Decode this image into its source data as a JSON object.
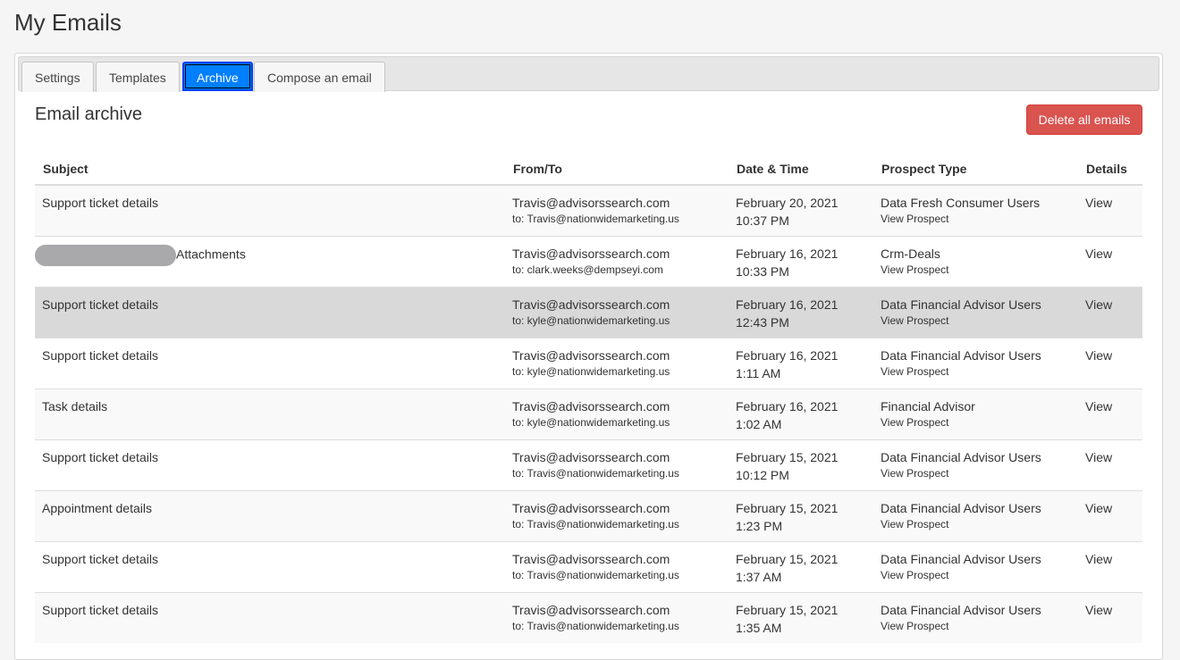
{
  "page_title": "My Emails",
  "tabs": [
    {
      "label": "Settings",
      "active": false
    },
    {
      "label": "Templates",
      "active": false
    },
    {
      "label": "Archive",
      "active": true
    },
    {
      "label": "Compose an email",
      "active": false
    }
  ],
  "section_title": "Email archive",
  "delete_all_label": "Delete all emails",
  "columns": [
    "Subject",
    "From/To",
    "Date & Time",
    "Prospect Type",
    "Details"
  ],
  "rows": [
    {
      "subject": "Support ticket details",
      "from": "Travis@advisorssearch.com",
      "to": "to: Travis@nationwidemarketing.us",
      "date": "February 20, 2021",
      "time": "10:37 PM",
      "type": "Data Fresh Consumer Users",
      "type_link": "View Prospect",
      "details": "View"
    },
    {
      "subject": "Attachments",
      "subject_redacted": true,
      "from": "Travis@advisorssearch.com",
      "to": "to: clark.weeks@dempseyi.com",
      "date": "February 16, 2021",
      "time": "10:33 PM",
      "type": "Crm-Deals",
      "type_link": "View Prospect",
      "details": "View"
    },
    {
      "subject": "Support ticket details",
      "from": "Travis@advisorssearch.com",
      "to": "to: kyle@nationwidemarketing.us",
      "date": "February 16, 2021",
      "time": "12:43 PM",
      "type": "Data Financial Advisor Users",
      "type_link": "View Prospect",
      "details": "View",
      "hover": true
    },
    {
      "subject": "Support ticket details",
      "from": "Travis@advisorssearch.com",
      "to": "to: kyle@nationwidemarketing.us",
      "date": "February 16, 2021",
      "time": "1:11 AM",
      "type": "Data Financial Advisor Users",
      "type_link": "View Prospect",
      "details": "View"
    },
    {
      "subject": "Task details",
      "from": "Travis@advisorssearch.com",
      "to": "to: kyle@nationwidemarketing.us",
      "date": "February 16, 2021",
      "time": "1:02 AM",
      "type": "Financial Advisor",
      "type_link": "View Prospect",
      "details": "View"
    },
    {
      "subject": "Support ticket details",
      "from": "Travis@advisorssearch.com",
      "to": "to: Travis@nationwidemarketing.us",
      "date": "February 15, 2021",
      "time": "10:12 PM",
      "type": "Data Financial Advisor Users",
      "type_link": "View Prospect",
      "details": "View"
    },
    {
      "subject": "Appointment details",
      "from": "Travis@advisorssearch.com",
      "to": "to: Travis@nationwidemarketing.us",
      "date": "February 15, 2021",
      "time": "1:23 PM",
      "type": "Data Financial Advisor Users",
      "type_link": "View Prospect",
      "details": "View"
    },
    {
      "subject": "Support ticket details",
      "from": "Travis@advisorssearch.com",
      "to": "to: Travis@nationwidemarketing.us",
      "date": "February 15, 2021",
      "time": "1:37 AM",
      "type": "Data Financial Advisor Users",
      "type_link": "View Prospect",
      "details": "View"
    },
    {
      "subject": "Support ticket details",
      "from": "Travis@advisorssearch.com",
      "to": "to: Travis@nationwidemarketing.us",
      "date": "February 15, 2021",
      "time": "1:35 AM",
      "type": "Data Financial Advisor Users",
      "type_link": "View Prospect",
      "details": "View"
    }
  ]
}
